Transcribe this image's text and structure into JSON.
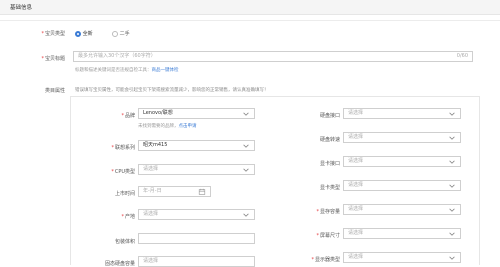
{
  "section_title": "基础信息",
  "type": {
    "label": "宝贝类型",
    "options": [
      {
        "label": "全新",
        "selected": true
      },
      {
        "label": "二手",
        "selected": false
      }
    ]
  },
  "title_field": {
    "label": "宝贝标题",
    "placeholder": "最多允许输入30个汉字（60字符）",
    "counter": "0/60",
    "hint_prefix": "标题和描述关键词是否违规自检工具：",
    "hint_link": "商品一键体检"
  },
  "attrs": {
    "label": "类目属性",
    "notice": "错误填写宝贝属性，可能会引起宝贝下架或搜索流量减少，影响您的正常销售，请认真准确填写！",
    "left": [
      {
        "label": "品牌",
        "required": true,
        "value": "Lenovo/联想",
        "kind": "select"
      },
      {
        "label": "联想系列",
        "required": true,
        "value": "昭天m415",
        "kind": "select"
      },
      {
        "label": "CPU类型",
        "required": true,
        "value": "请选择",
        "kind": "select"
      },
      {
        "label": "上市时间",
        "required": false,
        "value": "年-月-日",
        "kind": "date"
      },
      {
        "label": "产地",
        "required": true,
        "value": "请选择",
        "kind": "select"
      },
      {
        "label": "包装体积",
        "required": false,
        "value": "",
        "kind": "text"
      },
      {
        "label": "固态硬盘容量",
        "required": false,
        "value": "请选择",
        "kind": "select"
      }
    ],
    "brand_hint_prefix": "未找到需要的品牌，",
    "brand_hint_link": "点击申请",
    "right": [
      {
        "label": "硬盘接口",
        "required": false,
        "value": "请选择"
      },
      {
        "label": "硬盘转速",
        "required": false,
        "value": "请选择"
      },
      {
        "label": "显卡接口",
        "required": false,
        "value": "请选择"
      },
      {
        "label": "显卡类型",
        "required": false,
        "value": "请选择"
      },
      {
        "label": "显存容量",
        "required": true,
        "value": "请选择"
      },
      {
        "label": "屏幕尺寸",
        "required": true,
        "value": "请选择"
      },
      {
        "label": "显示器类型",
        "required": true,
        "value": "请选择"
      }
    ]
  },
  "colors": {
    "required": "#e4393c",
    "link": "#3a7bd5",
    "radio_active": "#3a7bd5"
  }
}
